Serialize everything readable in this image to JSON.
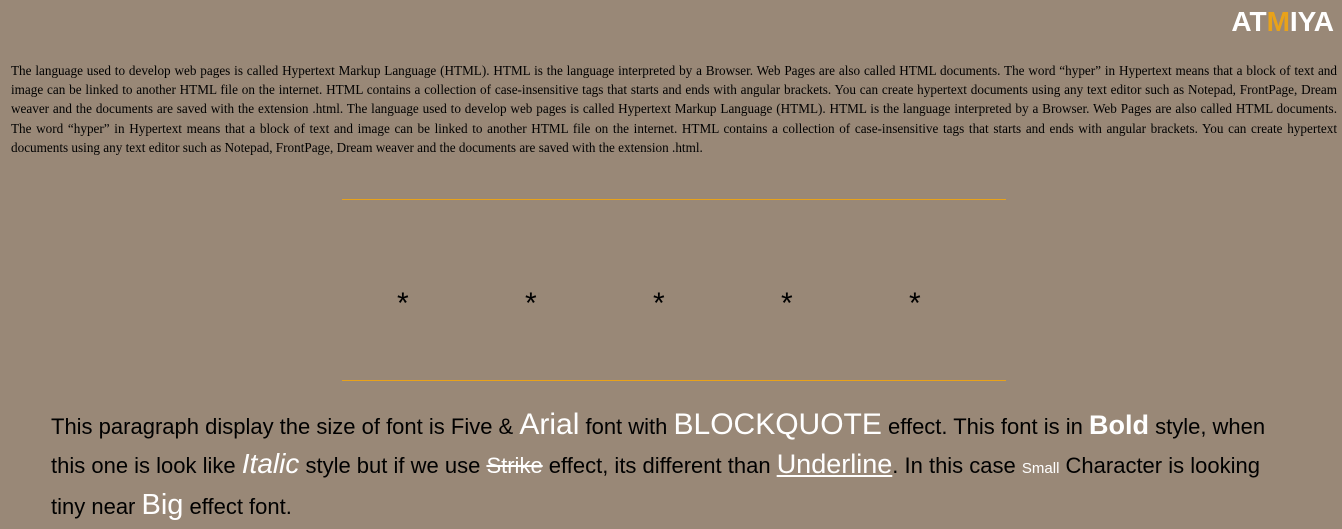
{
  "logo": {
    "prefix": "AT",
    "highlight": "M",
    "suffix": "IYA"
  },
  "intro_text": "The language used to develop web pages is called Hypertext Markup Language (HTML). HTML is the language interpreted by a Browser. Web Pages are also called HTML documents. The word “hyper” in Hypertext means that a block of text and image can be linked to another HTML file on the internet. HTML contains a collection of case-insensitive tags that starts and ends with angular brackets. You can create hypertext documents using any text editor such as Notepad, FrontPage, Dream weaver and the documents are saved with the extension .html. The language used to develop web pages is called Hypertext Markup Language (HTML). HTML is the language interpreted by a Browser. Web Pages are also called HTML documents. The word “hyper” in Hypertext means that a block of text and image can be linked to another HTML file on the internet. HTML contains a collection of case-insensitive tags that starts and ends with angular brackets. You can create hypertext documents using any text editor such as Notepad, FrontPage, Dream weaver and the documents are saved with the extension .html.",
  "stars": [
    "*",
    "*",
    "*",
    "*",
    "*"
  ],
  "quote": {
    "t1": "This paragraph display the size of font is Five & ",
    "arial": "Arial",
    "t2": " font with ",
    "blockquote": "BLOCKQUOTE",
    "t3": " effect. This font is in ",
    "bold": "Bold",
    "t4": " style, when this one is look like ",
    "italic": "Italic",
    "t5": " style but if we use ",
    "strike": "Strike",
    "t6": " effect, its different than ",
    "underline": "Underline",
    "t7": ". In this case ",
    "small": "Small",
    "t8": " Character is looking tiny near ",
    "big": "Big",
    "t9": " effect font."
  },
  "colors": {
    "background": "#998877",
    "accent": "#e8a21a",
    "highlight_text": "#ffffff"
  }
}
